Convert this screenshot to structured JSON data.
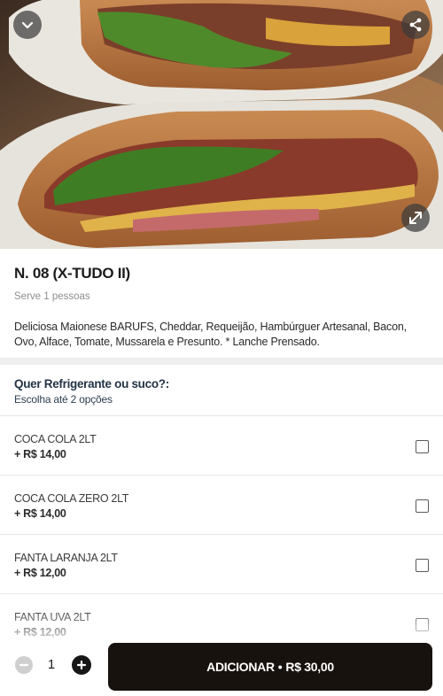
{
  "product": {
    "title": "N. 08 (X-TUDO II)",
    "serves": "Serve 1 pessoas",
    "description": "Deliciosa Maionese BARUFS, Cheddar, Requeijão, Hambúrguer Artesanal, Bacon, Ovo, Alface, Tomate, Mussarela e Presunto. * Lanche Prensado."
  },
  "hero": {
    "icons": {
      "back": "chevron-down-icon",
      "share": "share-icon",
      "expand": "expand-icon"
    }
  },
  "option_group": {
    "title": "Quer Refrigerante ou suco?:",
    "subtitle": "Escolha até 2 opções",
    "options": [
      {
        "name": "COCA COLA 2LT",
        "price": "+ R$ 14,00",
        "checked": false
      },
      {
        "name": "COCA COLA ZERO 2LT",
        "price": "+ R$ 14,00",
        "checked": false
      },
      {
        "name": "FANTA LARANJA 2LT",
        "price": "+ R$ 12,00",
        "checked": false
      },
      {
        "name": "FANTA UVA 2LT",
        "price": "+ R$ 12,00",
        "checked": false
      }
    ]
  },
  "footer": {
    "quantity": "1",
    "add_label": "ADICIONAR",
    "separator": "•",
    "add_price": "R$ 30,00"
  },
  "colors": {
    "button_bg": "#18120e",
    "divider": "#efefef",
    "group_title": "#243447"
  }
}
